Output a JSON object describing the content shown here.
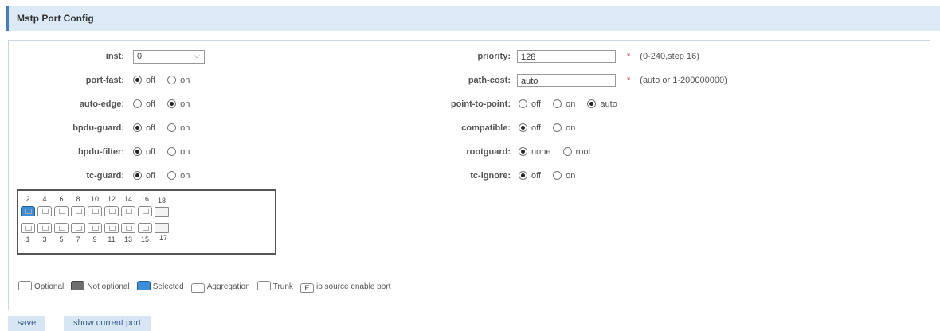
{
  "header": {
    "title": "Mstp Port Config"
  },
  "left_fields": {
    "inst": {
      "label": "inst:",
      "value": "0"
    },
    "port_fast": {
      "label": "port-fast:",
      "options": [
        "off",
        "on"
      ],
      "selected": "off"
    },
    "auto_edge": {
      "label": "auto-edge:",
      "options": [
        "off",
        "on"
      ],
      "selected": "on"
    },
    "bpdu_guard": {
      "label": "bpdu-guard:",
      "options": [
        "off",
        "on"
      ],
      "selected": "off"
    },
    "bpdu_filter": {
      "label": "bpdu-filter:",
      "options": [
        "off",
        "on"
      ],
      "selected": "off"
    },
    "tc_guard": {
      "label": "tc-guard:",
      "options": [
        "off",
        "on"
      ],
      "selected": "off"
    }
  },
  "right_fields": {
    "priority": {
      "label": "priority:",
      "value": "128",
      "required": "*",
      "hint": "(0-240,step 16)"
    },
    "path_cost": {
      "label": "path-cost:",
      "value": "auto",
      "required": "*",
      "hint": "(auto or 1-200000000)"
    },
    "point_to_point": {
      "label": "point-to-point:",
      "options": [
        "off",
        "on",
        "auto"
      ],
      "selected": "auto"
    },
    "compatible": {
      "label": "compatible:",
      "options": [
        "off",
        "on"
      ],
      "selected": "off"
    },
    "rootguard": {
      "label": "rootguard:",
      "options": [
        "none",
        "root"
      ],
      "selected": "none"
    },
    "tc_ignore": {
      "label": "tc-ignore:",
      "options": [
        "off",
        "on"
      ],
      "selected": "off"
    }
  },
  "ports": {
    "top_numbers": [
      "2",
      "4",
      "6",
      "8",
      "10",
      "12",
      "14",
      "16",
      "18"
    ],
    "bottom_numbers": [
      "1",
      "3",
      "5",
      "7",
      "9",
      "11",
      "13",
      "15",
      "17"
    ],
    "selected": [
      "2"
    ]
  },
  "legend": {
    "optional": "Optional",
    "not_optional": "Not optional",
    "selected": "Selected",
    "aggregation": "Aggregation",
    "aggregation_icon_text": "1",
    "trunk": "Trunk",
    "ip_source": "ip source enable port",
    "ip_source_icon_text": "E"
  },
  "buttons": {
    "save": "save",
    "show_current_port": "show current port"
  }
}
